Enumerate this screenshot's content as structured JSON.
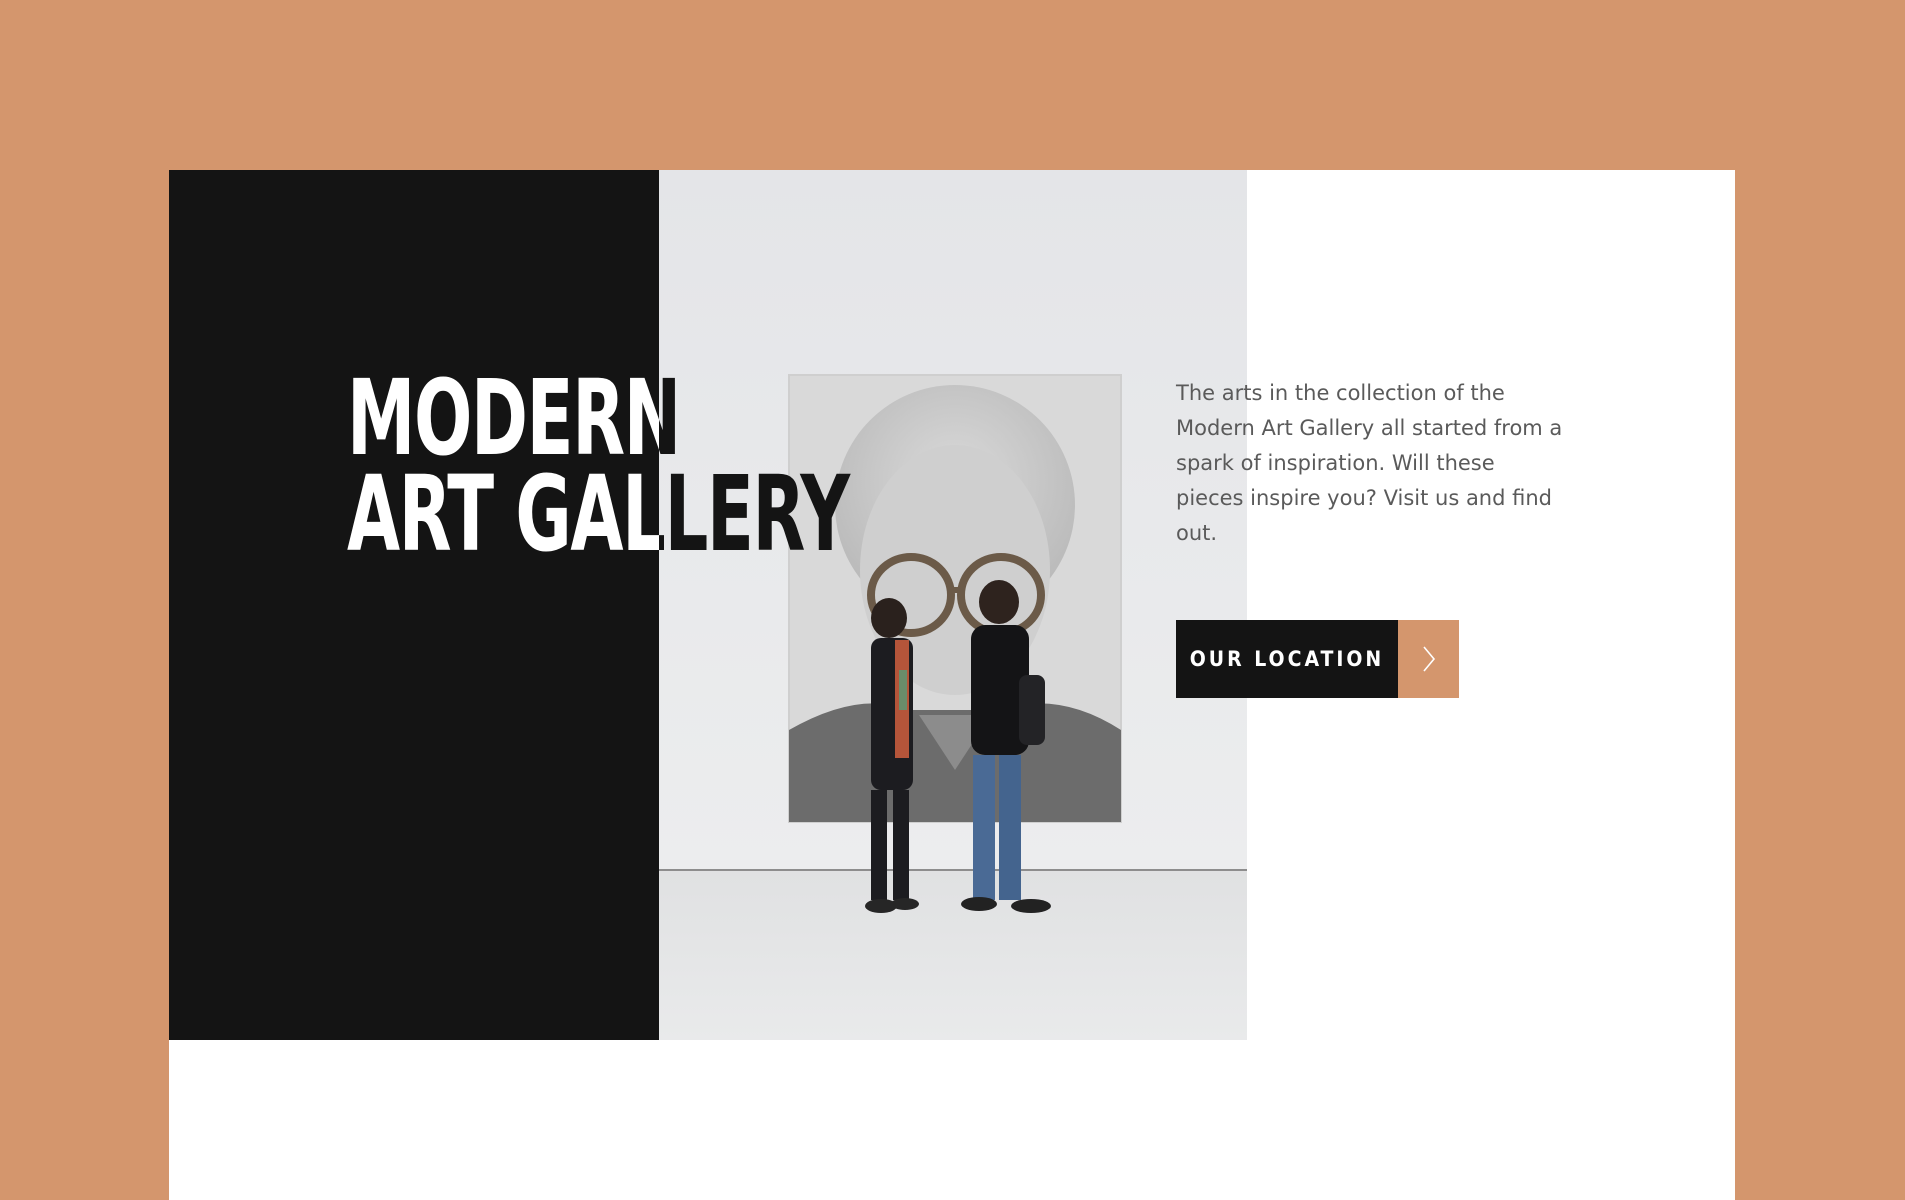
{
  "hero": {
    "title_line_1": "MODERN",
    "title_line_2": "ART GALLERY",
    "description": "The arts in the collection of the Modern Art Gallery all started from a spark of inspiration. Will these pieces inspire you? Visit us and find out.",
    "cta_label": "OUR LOCATION",
    "cta_icon": "chevron-right-icon",
    "photo_subject": "visitors-viewing-portrait"
  },
  "colors": {
    "background": "#d4966d",
    "card": "#ffffff",
    "dark_panel": "#141414",
    "accent": "#d4966d",
    "body_text": "#5a5a5a"
  }
}
